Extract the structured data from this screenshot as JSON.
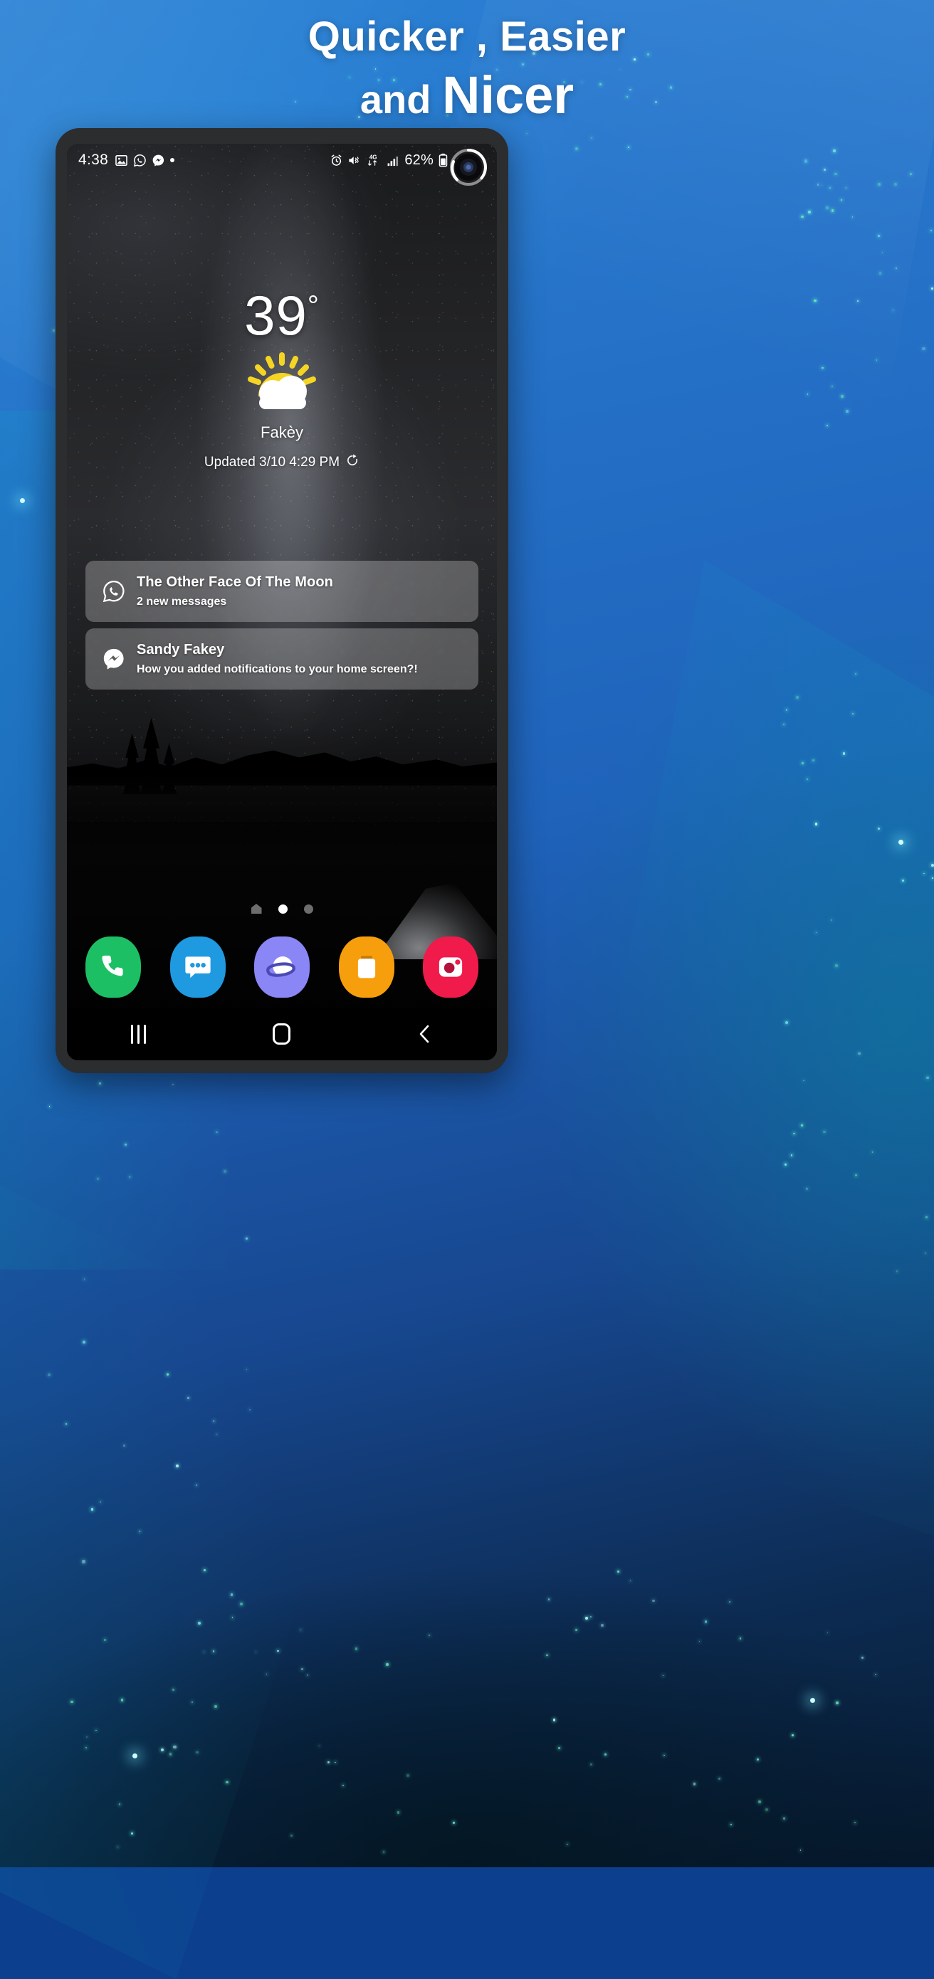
{
  "promo": {
    "headline_line1": "Quicker , Easier",
    "headline_line2_small": "and ",
    "headline_line2_big": "Nicer",
    "bg_top_color": "#2b7fd4",
    "bg_bottom_color": "#06182c",
    "particle_color": "#6ff0d8"
  },
  "phone": {
    "status_bar": {
      "clock": "4:38",
      "left_icons": [
        "gallery-icon",
        "whatsapp-icon",
        "messenger-icon",
        "dot-icon"
      ],
      "right_icons": [
        "alarm-icon",
        "mute-vibrate-icon",
        "4g-data-icon",
        "signal-bars-icon"
      ],
      "network_label": "4G",
      "battery_percent": "62%",
      "battery_icon": "battery-icon",
      "camera": "punch-hole-camera"
    },
    "weather": {
      "temperature": "39",
      "degree": "°",
      "condition_icon": "partly-cloudy-icon",
      "city": "Fakèy",
      "updated_label": "Updated 3/10 4:29 PM",
      "refresh_icon": "refresh-icon",
      "sun_color": "#F5D524",
      "cloud_color": "#FFFFFF"
    },
    "notifications": [
      {
        "icon": "whatsapp-icon",
        "title": "The Other Face Of The Moon",
        "body": "2 new messages"
      },
      {
        "icon": "messenger-icon",
        "title": "Sandy Fakey",
        "body": "How you added notifications to your home screen?!"
      }
    ],
    "page_indicator": {
      "items": [
        "home-page-icon",
        "page-dot-active",
        "page-dot"
      ],
      "active_index": 1
    },
    "dock": [
      {
        "name": "Phone",
        "icon": "phone-icon",
        "color": "#1DBF65"
      },
      {
        "name": "Messages",
        "icon": "messages-icon",
        "color": "#1F9AE0"
      },
      {
        "name": "Internet",
        "icon": "internet-icon",
        "color": "#8B86F5"
      },
      {
        "name": "My Files",
        "icon": "files-icon",
        "color": "#F79E0C"
      },
      {
        "name": "Camera",
        "icon": "camera-icon",
        "color": "#F01A4B"
      }
    ],
    "nav_bar": [
      {
        "name": "Recents",
        "icon": "recents-icon"
      },
      {
        "name": "Home",
        "icon": "home-icon"
      },
      {
        "name": "Back",
        "icon": "back-icon"
      }
    ]
  }
}
